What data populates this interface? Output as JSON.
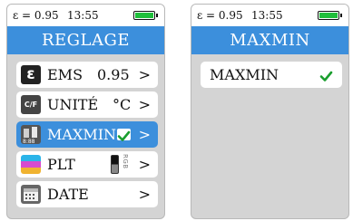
{
  "status": {
    "emissivity": "ε = 0.95",
    "time": "13:55",
    "colors": {
      "battery": "#1fbf3b",
      "accent": "#3c8fdc"
    }
  },
  "left_screen": {
    "title": "REGLAGE",
    "items": [
      {
        "icon": "emissivity-icon",
        "icon_text": "ε",
        "label": "EMS",
        "value": "0.95",
        "arrow": ">"
      },
      {
        "icon": "unit-icon",
        "icon_text": "C/F",
        "label": "UNITÉ",
        "value": "°C",
        "arrow": ">"
      },
      {
        "icon": "maxmin-icon",
        "label": "MAXMIN",
        "checked": true,
        "arrow": ">"
      },
      {
        "icon": "palette-icon",
        "label": "PLT",
        "value": "RGB",
        "arrow": ">"
      },
      {
        "icon": "calendar-icon",
        "label": "DATE",
        "arrow": ">"
      }
    ]
  },
  "right_screen": {
    "title": "MAXMIN",
    "item": {
      "label": "MAXMIN",
      "checked": true
    }
  }
}
